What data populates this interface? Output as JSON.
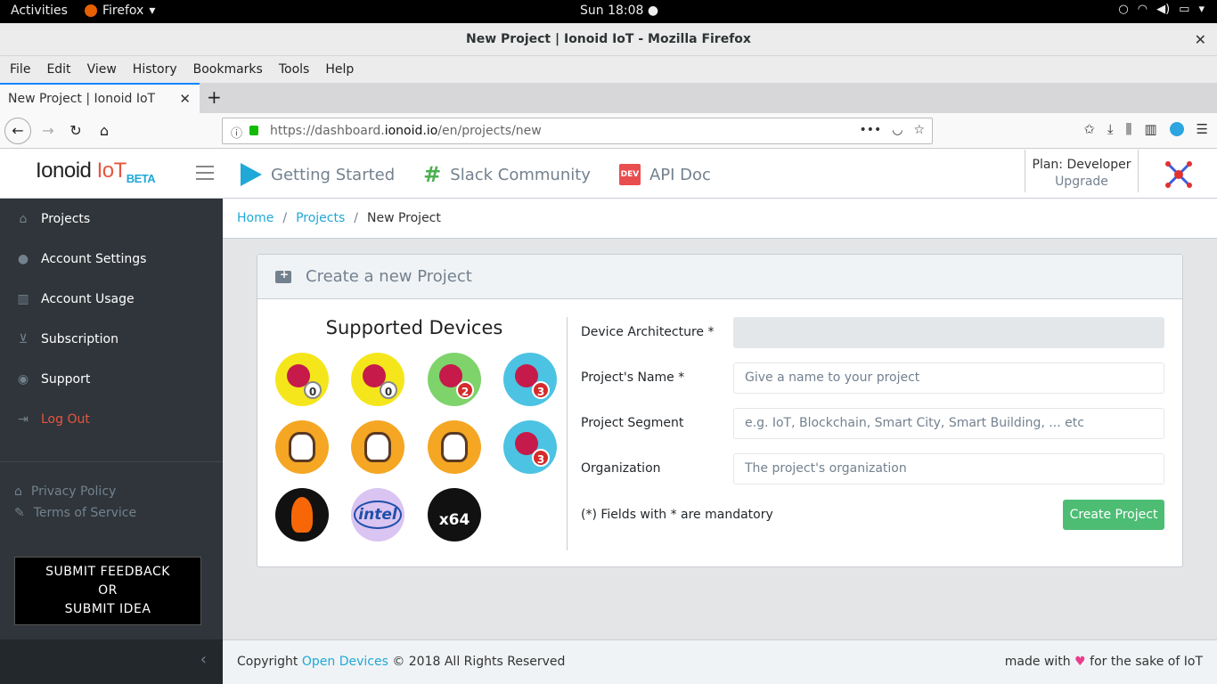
{
  "system": {
    "activities": "Activities",
    "app_name": "Firefox",
    "clock": "Sun 18:08 ●"
  },
  "window": {
    "title": "New Project | Ionoid IoT - Mozilla Firefox",
    "close": "✕"
  },
  "menubar": [
    "File",
    "Edit",
    "View",
    "History",
    "Bookmarks",
    "Tools",
    "Help"
  ],
  "tab": {
    "title": "New Project | Ionoid IoT",
    "close": "✕",
    "new": "+"
  },
  "url": {
    "prefix": "https://dashboard.",
    "domain": "ionoid.io",
    "path": "/en/projects/new"
  },
  "brand": {
    "name": "Ionoid",
    "iot": "IoT",
    "beta": "BETA"
  },
  "header_nav": [
    {
      "label": "Getting Started",
      "icon": "play-icon"
    },
    {
      "label": "Slack Community",
      "icon": "slack-icon"
    },
    {
      "label": "API Doc",
      "icon": "dev-icon",
      "icon_text": "DEV"
    }
  ],
  "plan": {
    "label": "Plan: Developer",
    "upgrade": "Upgrade"
  },
  "sidebar": {
    "items": [
      {
        "label": "Projects",
        "icon": "home-icon"
      },
      {
        "label": "Account Settings",
        "icon": "user-icon"
      },
      {
        "label": "Account Usage",
        "icon": "chart-icon"
      },
      {
        "label": "Subscription",
        "icon": "cart-icon"
      },
      {
        "label": "Support",
        "icon": "comment-icon"
      },
      {
        "label": "Log Out",
        "icon": "logout-icon"
      }
    ],
    "privacy": "Privacy Policy",
    "terms": "Terms of Service",
    "feedback_line1": "SUBMIT FEEDBACK",
    "feedback_line2": "OR",
    "feedback_line3": "SUBMIT IDEA",
    "collapse": "‹"
  },
  "breadcrumb": {
    "home": "Home",
    "projects": "Projects",
    "current": "New Project",
    "sep": "/"
  },
  "card": {
    "title": "Create a new Project",
    "devices_title": "Supported Devices",
    "devices": [
      {
        "name": "raspberry-pi-zero",
        "badge": "0",
        "color": "#f5e61c"
      },
      {
        "name": "raspberry-pi-zero-w",
        "badge": "0",
        "color": "#f5e61c"
      },
      {
        "name": "raspberry-pi-2",
        "badge": "2",
        "color": "#7ed36b"
      },
      {
        "name": "raspberry-pi-3",
        "badge": "3",
        "color": "#4cc3e3"
      },
      {
        "name": "beaglebone-black",
        "badge": "",
        "color": "#f5a623"
      },
      {
        "name": "beaglebone",
        "badge": "",
        "color": "#f5a623"
      },
      {
        "name": "beaglebone-wireless",
        "badge": "",
        "color": "#f5a623"
      },
      {
        "name": "raspberry-pi-3-b",
        "badge": "3",
        "color": "#4cc3e3"
      },
      {
        "name": "linux-arm",
        "badge": "",
        "color": "#111111"
      },
      {
        "name": "intel",
        "badge": "intel",
        "color": "#d9c4f2"
      },
      {
        "name": "linux-x64",
        "badge": "x64",
        "color": "#111111"
      }
    ],
    "fields": {
      "arch_label": "Device Architecture *",
      "arch_value": "",
      "name_label": "Project's Name *",
      "name_placeholder": "Give a name to your project",
      "segment_label": "Project Segment",
      "segment_placeholder": "e.g. IoT, Blockchain, Smart City, Smart Building, ... etc",
      "org_label": "Organization",
      "org_placeholder": "The project's organization"
    },
    "mandatory_note": "(*) Fields with * are mandatory",
    "create_button": "Create Project"
  },
  "footer": {
    "copyright": "Copyright ",
    "company": "Open Devices",
    "rights": " © 2018 All Rights Reserved",
    "made_with": "made with ",
    "heart": "♥",
    "sake": " for the sake of IoT"
  },
  "colors": {
    "sidebar_bg": "#2f353a",
    "accent": "#20a8d8",
    "create_button": "#4dbd74",
    "logout": "#e8553e"
  }
}
